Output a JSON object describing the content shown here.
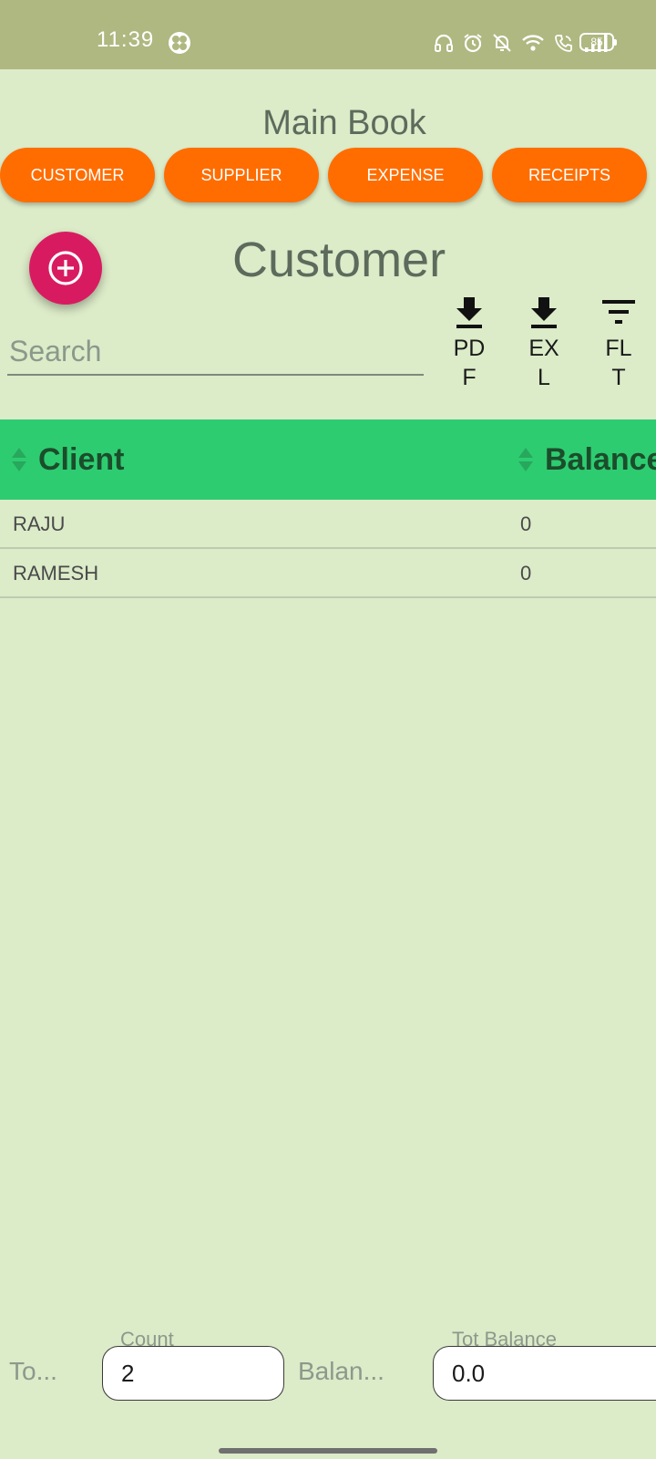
{
  "status_bar": {
    "time": "11:39",
    "battery": "85",
    "icons": [
      "app-notification-icon",
      "headphones-icon",
      "alarm-icon",
      "notifications-off-icon",
      "wifi-icon",
      "wifi-calling-icon",
      "signal-icon",
      "battery-icon"
    ]
  },
  "header": {
    "title": "Main Book"
  },
  "nav": {
    "tabs": [
      {
        "label": "CUSTOMER"
      },
      {
        "label": "SUPPLIER"
      },
      {
        "label": "EXPENSE"
      },
      {
        "label": "RECEIPTS"
      }
    ]
  },
  "section": {
    "title": "Customer",
    "add_icon": "add-circle-icon"
  },
  "search": {
    "placeholder": "Search",
    "value": ""
  },
  "toolbar": {
    "pdf_label": "PDF",
    "excel_label": "EXL",
    "filter_label": "FLT",
    "pdf_icon": "download-icon",
    "excel_icon": "download-icon",
    "filter_icon": "filter-icon"
  },
  "table": {
    "columns": [
      "Client",
      "Balance"
    ],
    "rows": [
      {
        "client": "RAJU",
        "balance": "0"
      },
      {
        "client": "RAMESH",
        "balance": "0"
      }
    ]
  },
  "footer": {
    "total_label": "To...",
    "count_label": "Count",
    "count_value": "2",
    "balance_label": "Balan...",
    "tot_balance_label": "Tot Balance",
    "tot_balance_value": "0.0"
  },
  "colors": {
    "background": "#dcebc8",
    "status_bar": "#aeb880",
    "tab_orange": "#ff6d00",
    "fab_pink": "#d81b60",
    "table_header_green": "#2ecc71"
  }
}
